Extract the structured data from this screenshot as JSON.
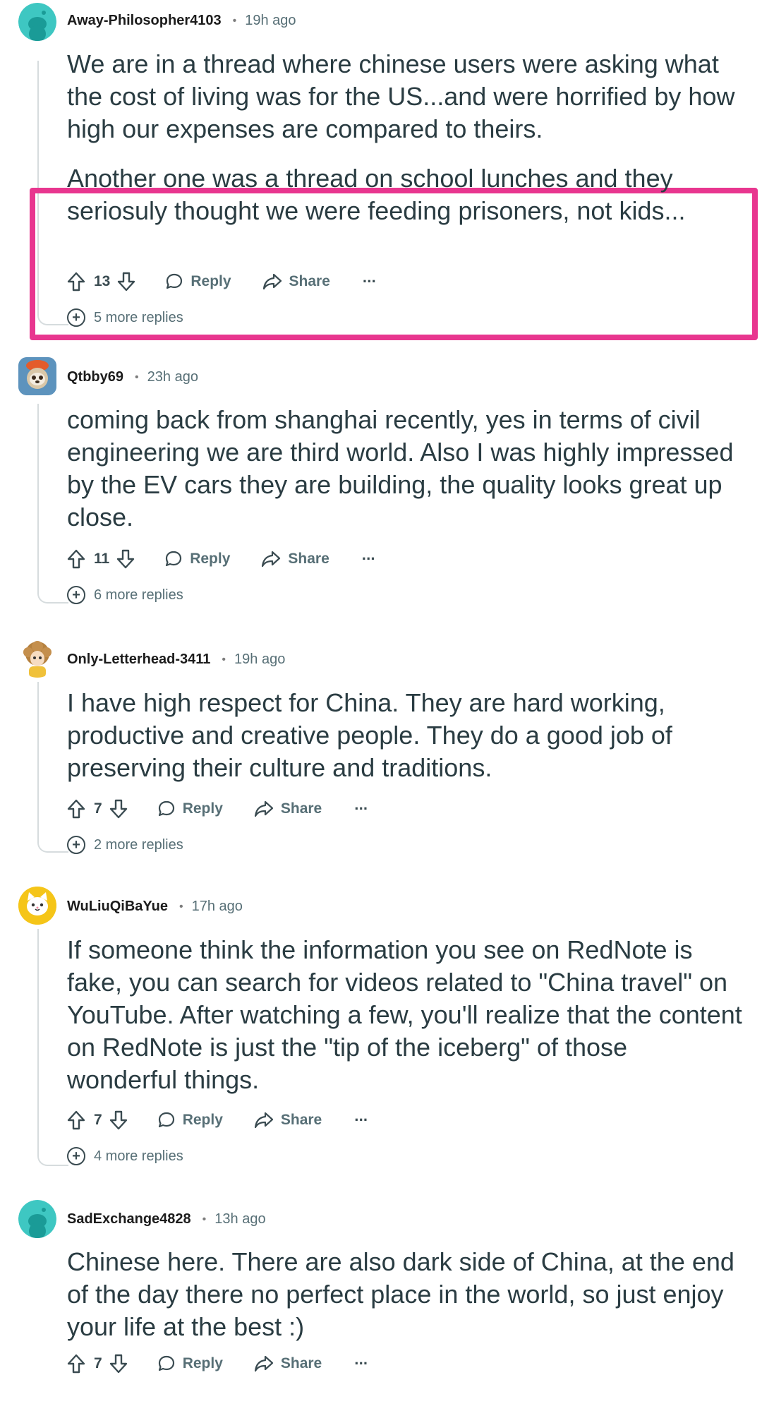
{
  "comments": [
    {
      "author": "Away-Philosopher4103",
      "time": "19h ago",
      "paragraphs": [
        "We are in a thread where chinese users were asking what the cost of living was for the US...and were horrified by how high our expenses are compared to theirs.",
        "Another one was a thread on school lunches and they seriosuly thought we were feeding prisoners, not kids..."
      ],
      "score": "13",
      "reply_label": "Reply",
      "share_label": "Share",
      "more_replies": "5 more replies",
      "avatar_icon": "reddit-snoo-teal-icon"
    },
    {
      "author": "Qtbby69",
      "time": "23h ago",
      "paragraphs": [
        "coming back from shanghai recently, yes in terms of civil engineering we are third world. Also I was highly impressed by the EV cars they are building, the quality looks great up close."
      ],
      "score": "11",
      "reply_label": "Reply",
      "share_label": "Share",
      "more_replies": "6 more replies",
      "avatar_icon": "sloth-avatar-icon"
    },
    {
      "author": "Only-Letterhead-3411",
      "time": "19h ago",
      "paragraphs": [
        "I have high respect for China. They are hard working, productive and creative people. They do a good job of preserving their culture and traditions."
      ],
      "score": "7",
      "reply_label": "Reply",
      "share_label": "Share",
      "more_replies": "2 more replies",
      "avatar_icon": "curly-hair-avatar-icon"
    },
    {
      "author": "WuLiuQiBaYue",
      "time": "17h ago",
      "paragraphs": [
        "If someone think the information you see on RedNote is fake, you can search for videos related to \"China travel\" on YouTube. After watching a few, you'll realize that the content on RedNote is just the \"tip of the iceberg\" of those wonderful things."
      ],
      "score": "7",
      "reply_label": "Reply",
      "share_label": "Share",
      "more_replies": "4 more replies",
      "avatar_icon": "cat-avatar-icon"
    },
    {
      "author": "SadExchange4828",
      "time": "13h ago",
      "paragraphs": [
        "Chinese here. There are also dark side of China, at the end of the day there no perfect place in the world, so just enjoy your life at the best :)"
      ],
      "score": "7",
      "reply_label": "Reply",
      "share_label": "Share",
      "avatar_icon": "reddit-snoo-teal-icon"
    }
  ],
  "colors": {
    "highlight": "#e8368f",
    "text": "#2a3c42",
    "muted": "#576f76",
    "snoo_teal": "#3ec7c2"
  }
}
